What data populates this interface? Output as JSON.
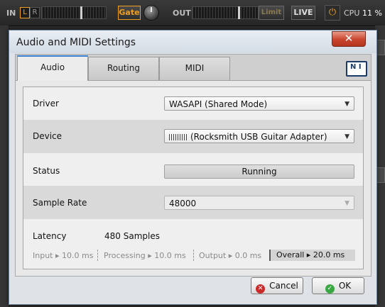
{
  "toolbar": {
    "in_label": "IN",
    "l_label": "L",
    "r_label": "R",
    "gate_label": "Gate",
    "out_label": "OUT",
    "limit_label": "Limit",
    "live_label": "LIVE",
    "cpu_label": "CPU",
    "cpu_value": "11 %",
    "accent": "#f0a020"
  },
  "dialog": {
    "title": "Audio and MIDI Settings",
    "close_glyph": "✕",
    "tabs": [
      {
        "label": "Audio"
      },
      {
        "label": "Routing"
      },
      {
        "label": "MIDI"
      }
    ],
    "logo_text": "N I",
    "settings": {
      "driver": {
        "label": "Driver",
        "value": "WASAPI (Shared Mode)"
      },
      "device": {
        "label": "Device",
        "value": "(Rocksmith USB Guitar Adapter)"
      },
      "status": {
        "label": "Status",
        "value": "Running"
      },
      "sample_rate": {
        "label": "Sample Rate",
        "value": "48000"
      }
    },
    "latency": {
      "label": "Latency",
      "value": "480 Samples",
      "input": "Input ▸ 10.0 ms",
      "processing": "Processing ▸ 10.0 ms",
      "output": "Output ▸ 0.0 ms",
      "overall": "Overall ▸ 20.0 ms"
    },
    "buttons": {
      "cancel": "Cancel",
      "ok": "OK"
    }
  }
}
